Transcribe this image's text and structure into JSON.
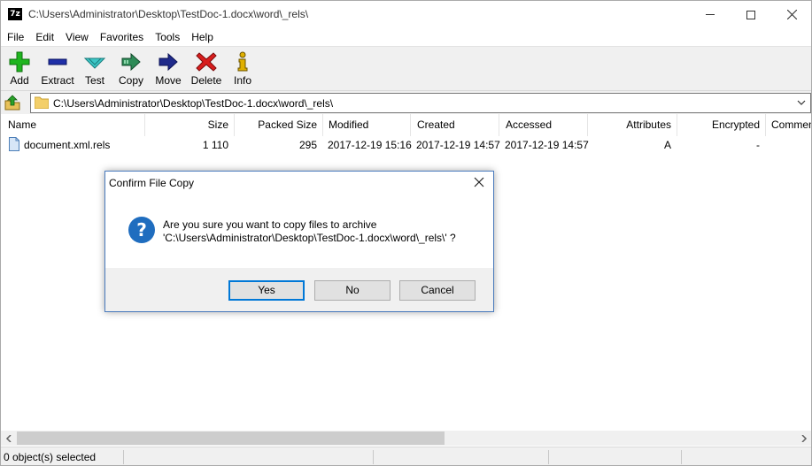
{
  "window": {
    "title": "C:\\Users\\Administrator\\Desktop\\TestDoc-1.docx\\word\\_rels\\",
    "app_icon_text": "7z"
  },
  "menu": [
    "File",
    "Edit",
    "View",
    "Favorites",
    "Tools",
    "Help"
  ],
  "toolbar": {
    "add": "Add",
    "extract": "Extract",
    "test": "Test",
    "copy": "Copy",
    "move": "Move",
    "delete": "Delete",
    "info": "Info"
  },
  "address": {
    "path": "C:\\Users\\Administrator\\Desktop\\TestDoc-1.docx\\word\\_rels\\"
  },
  "columns": {
    "name": "Name",
    "size": "Size",
    "packed_size": "Packed Size",
    "modified": "Modified",
    "created": "Created",
    "accessed": "Accessed",
    "attributes": "Attributes",
    "encrypted": "Encrypted",
    "comment": "Commen"
  },
  "files": [
    {
      "name": "document.xml.rels",
      "size": "1 110",
      "packed_size": "295",
      "modified": "2017-12-19 15:16",
      "created": "2017-12-19 14:57",
      "accessed": "2017-12-19 14:57",
      "attributes": "A",
      "encrypted": "-"
    }
  ],
  "status": {
    "selected": "0 object(s) selected"
  },
  "dialog": {
    "title": "Confirm File Copy",
    "line1": "Are you sure you want to copy files to archive",
    "line2": "'C:\\Users\\Administrator\\Desktop\\TestDoc-1.docx\\word\\_rels\\' ?",
    "yes": "Yes",
    "no": "No",
    "cancel": "Cancel"
  },
  "colors": {
    "add": "#1fb51f",
    "extract": "#1f2fa8",
    "test": "#3cc6c6",
    "copy": "#2e8b57",
    "move": "#1f2a8a",
    "delete": "#d81e1e",
    "info": "#e0b000",
    "dialog_border": "#4a7bbd",
    "default_button": "#0078d7",
    "question_icon": "#1f6dbf"
  }
}
